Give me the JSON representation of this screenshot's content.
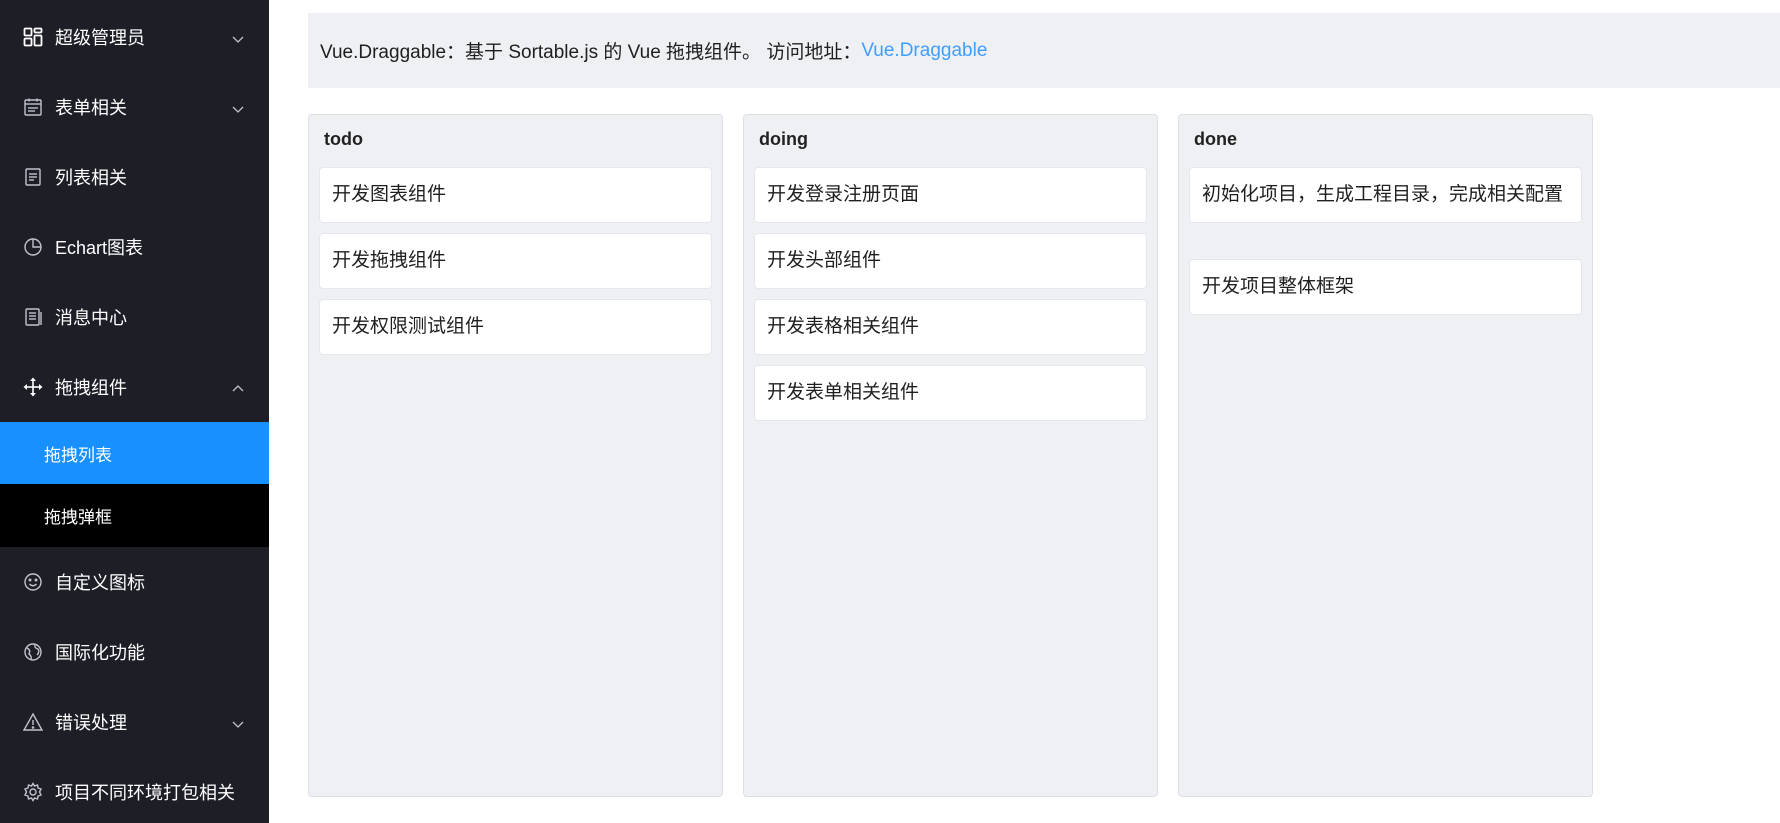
{
  "sidebar": {
    "items": [
      {
        "label": "超级管理员",
        "icon": "dashboard-grid-icon"
      },
      {
        "label": "表单相关",
        "icon": "calendar-icon"
      },
      {
        "label": "列表相关",
        "icon": "document-list-icon"
      },
      {
        "label": "Echart图表",
        "icon": "pie-chart-icon"
      },
      {
        "label": "消息中心",
        "icon": "message-doc-icon"
      },
      {
        "label": "拖拽组件",
        "icon": "move-arrows-icon"
      },
      {
        "label": "自定义图标",
        "icon": "smile-icon"
      },
      {
        "label": "国际化功能",
        "icon": "globe-icon"
      },
      {
        "label": "错误处理",
        "icon": "warning-icon"
      },
      {
        "label": "项目不同环境打包相关",
        "icon": "gear-icon"
      }
    ],
    "drag_submenu": [
      {
        "label": "拖拽列表",
        "selected": true
      },
      {
        "label": "拖拽弹框",
        "selected": false
      }
    ]
  },
  "notice": {
    "text": "Vue.Draggable：基于 Sortable.js 的 Vue 拖拽组件。 访问地址：",
    "link_text": "Vue.Draggable"
  },
  "columns": [
    {
      "title": "todo",
      "cards": [
        "开发图表组件",
        "开发拖拽组件",
        "开发权限测试组件"
      ]
    },
    {
      "title": "doing",
      "cards": [
        "开发登录注册页面",
        "开发头部组件",
        "开发表格相关组件",
        "开发表单相关组件"
      ]
    },
    {
      "title": "done",
      "cards": [
        "初始化项目，生成工程目录，完成相关配置",
        "开发项目整体框架"
      ]
    }
  ],
  "colors": {
    "sidebar_bg": "#1d1e26",
    "submenu_bg": "#000000",
    "selected": "#1890ff",
    "link": "#409eff",
    "panel_bg": "#eef0f4"
  }
}
